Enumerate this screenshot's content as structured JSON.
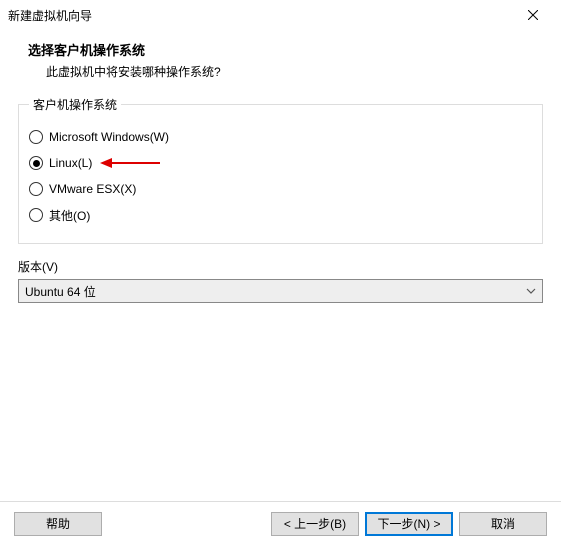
{
  "window": {
    "title": "新建虚拟机向导"
  },
  "header": {
    "title": "选择客户机操作系统",
    "subtitle": "此虚拟机中将安装哪种操作系统?"
  },
  "os_group": {
    "legend": "客户机操作系统",
    "options": [
      {
        "label": "Microsoft Windows(W)",
        "checked": false
      },
      {
        "label": "Linux(L)",
        "checked": true,
        "arrow": true
      },
      {
        "label": "VMware ESX(X)",
        "checked": false
      },
      {
        "label": "其他(O)",
        "checked": false
      }
    ]
  },
  "version": {
    "label": "版本(V)",
    "selected": "Ubuntu 64 位"
  },
  "buttons": {
    "help": "帮助",
    "back": "< 上一步(B)",
    "next": "下一步(N) >",
    "cancel": "取消"
  }
}
